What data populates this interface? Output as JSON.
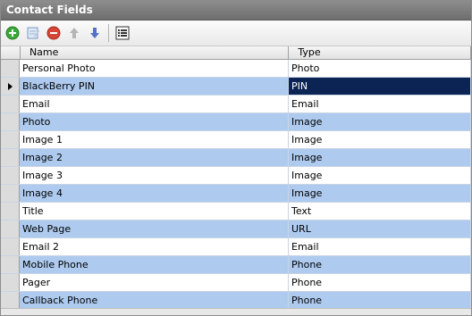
{
  "panel": {
    "title": "Contact Fields"
  },
  "toolbar": {
    "buttons": [
      {
        "name": "add-button",
        "icon": "plus-circle-icon",
        "color": "#3aa63a"
      },
      {
        "name": "edit-button",
        "icon": "edit-document-icon",
        "color": "#7a9ac6"
      },
      {
        "name": "delete-button",
        "icon": "minus-circle-icon",
        "color": "#d64535"
      },
      {
        "name": "move-up-button",
        "icon": "arrow-up-icon",
        "color": "#a9a9a9"
      },
      {
        "name": "move-down-button",
        "icon": "arrow-down-icon",
        "color": "#5470c8"
      },
      {
        "name": "properties-button",
        "icon": "list-icon",
        "color": "#333333"
      }
    ]
  },
  "grid": {
    "columns": {
      "name": "Name",
      "type": "Type"
    },
    "rows": [
      {
        "name": "Personal Photo",
        "type": "Photo",
        "style": "white"
      },
      {
        "name": "BlackBerry PIN",
        "type": "PIN",
        "style": "alt",
        "current": true
      },
      {
        "name": "Email",
        "type": "Email",
        "style": "white"
      },
      {
        "name": "Photo",
        "type": "Image",
        "style": "alt"
      },
      {
        "name": "Image 1",
        "type": "Image",
        "style": "white"
      },
      {
        "name": "Image 2",
        "type": "Image",
        "style": "alt"
      },
      {
        "name": "Image 3",
        "type": "Image",
        "style": "white"
      },
      {
        "name": "Image 4",
        "type": "Image",
        "style": "alt"
      },
      {
        "name": "Title",
        "type": "Text",
        "style": "white"
      },
      {
        "name": "Web Page",
        "type": "URL",
        "style": "alt"
      },
      {
        "name": "Email 2",
        "type": "Email",
        "style": "white"
      },
      {
        "name": "Mobile Phone",
        "type": "Phone",
        "style": "alt"
      },
      {
        "name": "Pager",
        "type": "Phone",
        "style": "white"
      },
      {
        "name": "Callback Phone",
        "type": "Phone",
        "style": "alt"
      }
    ]
  },
  "colors": {
    "row_alt": "#aecbef",
    "selection": "#0c2454",
    "title_bar": "#7a7a7a"
  }
}
